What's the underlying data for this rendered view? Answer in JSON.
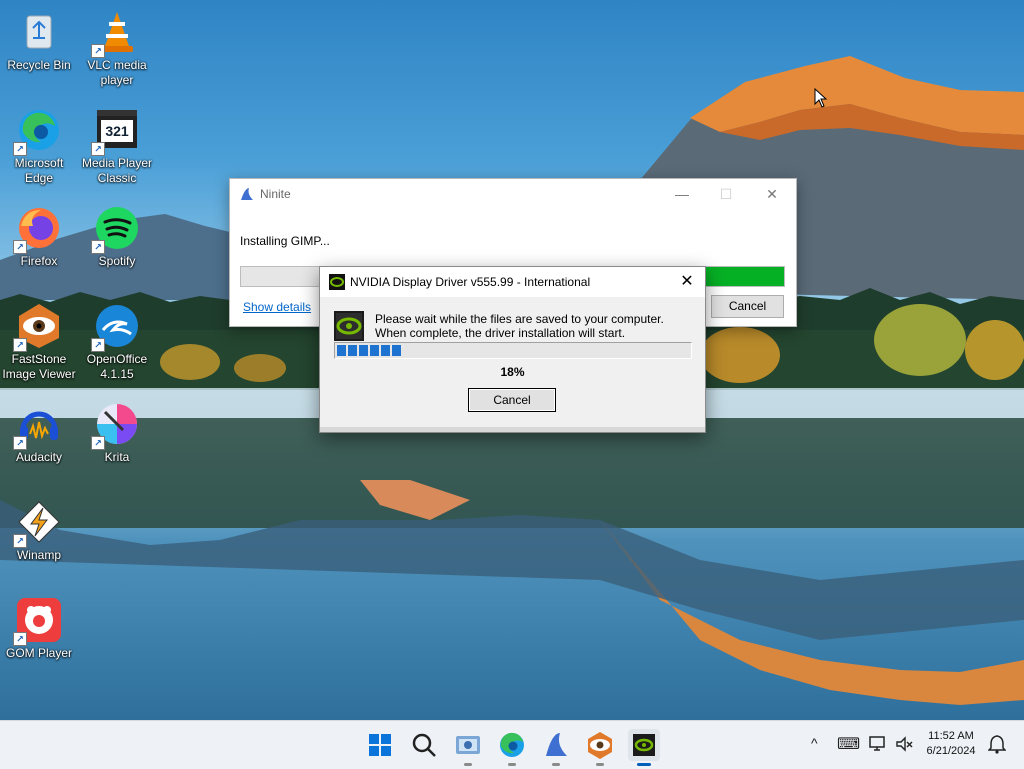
{
  "desktop": {
    "icons": [
      {
        "id": "recycle-bin",
        "label": "Recycle Bin"
      },
      {
        "id": "vlc",
        "label": "VLC media player"
      },
      {
        "id": "edge",
        "label": "Microsoft Edge"
      },
      {
        "id": "mpc",
        "label": "Media Player Classic"
      },
      {
        "id": "firefox",
        "label": "Firefox"
      },
      {
        "id": "spotify",
        "label": "Spotify"
      },
      {
        "id": "faststone",
        "label": "FastStone Image Viewer"
      },
      {
        "id": "openoffice",
        "label": "OpenOffice 4.1.15"
      },
      {
        "id": "audacity",
        "label": "Audacity"
      },
      {
        "id": "krita",
        "label": "Krita"
      },
      {
        "id": "winamp",
        "label": "Winamp"
      },
      {
        "id": "gom",
        "label": "GOM Player"
      }
    ],
    "mpc_badge": "321",
    "shortcut_glyph": "↗"
  },
  "ninite": {
    "title": "Ninite",
    "status": "Installing GIMP...",
    "details_link": "Show details",
    "cancel_label": "Cancel",
    "minimize_glyph": "—",
    "maximize_glyph": "☐",
    "close_glyph": "✕"
  },
  "nvidia": {
    "title": "NVIDIA Display Driver v555.99 - International",
    "message_line1": "Please wait while the files are saved to your computer.",
    "message_line2": "When complete, the driver installation will start.",
    "progress": 0.18,
    "percent_text": "18%",
    "cancel_label": "Cancel",
    "close_glyph": "✕"
  },
  "taskbar": {
    "apps": [
      "start-icon",
      "search-icon",
      "faststone-icon",
      "edge-icon",
      "ninite-icon",
      "faststone-viewer-icon",
      "nvidia-icon"
    ],
    "tray": {
      "chevron": "^",
      "keyboard": "⌨",
      "time": "11:52 AM",
      "date": "6/21/2024"
    }
  },
  "colors": {
    "accent": "#005fb8",
    "nvidia_green": "#76b900",
    "ninite_progress": "#06b025",
    "nvidia_progress": "#1e73d0"
  }
}
